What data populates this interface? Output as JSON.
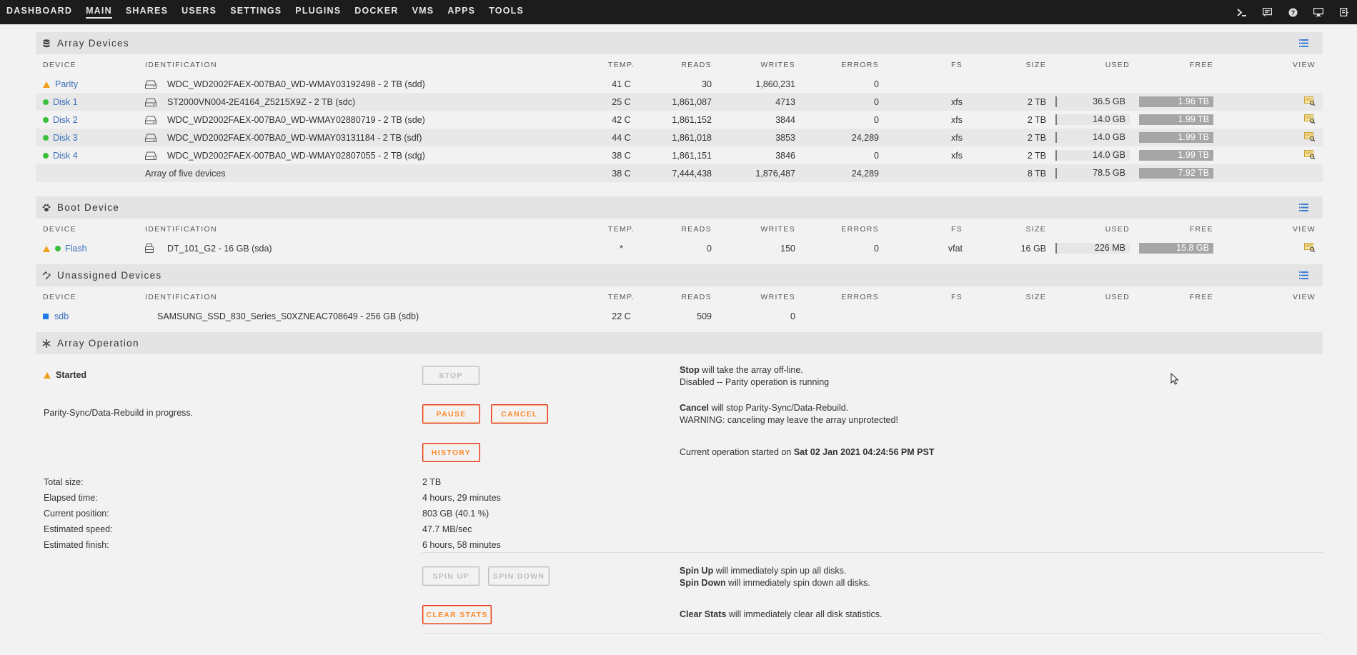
{
  "nav": {
    "items": [
      "DASHBOARD",
      "MAIN",
      "SHARES",
      "USERS",
      "SETTINGS",
      "PLUGINS",
      "DOCKER",
      "VMS",
      "APPS",
      "TOOLS"
    ],
    "active": "MAIN",
    "right_icons": [
      "terminal-icon",
      "feedback-icon",
      "help-icon",
      "monitor-icon",
      "log-icon"
    ]
  },
  "columns": [
    "DEVICE",
    "IDENTIFICATION",
    "TEMP.",
    "READS",
    "WRITES",
    "ERRORS",
    "FS",
    "SIZE",
    "USED",
    "FREE",
    "VIEW"
  ],
  "array": {
    "title": "Array Devices",
    "rows": [
      {
        "status": "warn",
        "device": "Parity",
        "id": "WDC_WD2002FAEX-007BA0_WD-WMAY03192498 - 2 TB (sdd)",
        "temp": "41 C",
        "reads": "30",
        "writes": "1,860,231",
        "errors": "0",
        "fs": "",
        "size": "",
        "used": "",
        "free": "",
        "view": false
      },
      {
        "status": "ok",
        "device": "Disk 1",
        "id": "ST2000VN004-2E4164_Z5215X9Z - 2 TB (sdc)",
        "temp": "25 C",
        "reads": "1,861,087",
        "writes": "4713",
        "errors": "0",
        "fs": "xfs",
        "size": "2 TB",
        "used": "36.5 GB",
        "free": "1.96 TB",
        "view": true
      },
      {
        "status": "ok",
        "device": "Disk 2",
        "id": "WDC_WD2002FAEX-007BA0_WD-WMAY02880719 - 2 TB (sde)",
        "temp": "42 C",
        "reads": "1,861,152",
        "writes": "3844",
        "errors": "0",
        "fs": "xfs",
        "size": "2 TB",
        "used": "14.0 GB",
        "free": "1.99 TB",
        "view": true
      },
      {
        "status": "ok",
        "device": "Disk 3",
        "id": "WDC_WD2002FAEX-007BA0_WD-WMAY03131184 - 2 TB (sdf)",
        "temp": "44 C",
        "reads": "1,861,018",
        "writes": "3853",
        "errors": "24,289",
        "fs": "xfs",
        "size": "2 TB",
        "used": "14.0 GB",
        "free": "1.99 TB",
        "view": true
      },
      {
        "status": "ok",
        "device": "Disk 4",
        "id": "WDC_WD2002FAEX-007BA0_WD-WMAY02807055 - 2 TB (sdg)",
        "temp": "38 C",
        "reads": "1,861,151",
        "writes": "3846",
        "errors": "0",
        "fs": "xfs",
        "size": "2 TB",
        "used": "14.0 GB",
        "free": "1.99 TB",
        "view": true
      }
    ],
    "total": {
      "id": "Array of five devices",
      "temp": "38 C",
      "reads": "7,444,438",
      "writes": "1,876,487",
      "errors": "24,289",
      "size": "8 TB",
      "used": "78.5 GB",
      "free": "7.92 TB"
    }
  },
  "boot": {
    "title": "Boot Device",
    "rows": [
      {
        "device": "Flash",
        "id": "DT_101_G2 - 16 GB (sda)",
        "temp": "*",
        "reads": "0",
        "writes": "150",
        "errors": "0",
        "fs": "vfat",
        "size": "16 GB",
        "used": "226 MB",
        "free": "15.8 GB"
      }
    ]
  },
  "unassigned": {
    "title": "Unassigned Devices",
    "rows": [
      {
        "device": "sdb",
        "id": "SAMSUNG_SSD_830_Series_S0XZNEAC708649 - 256 GB (sdb)",
        "temp": "22 C",
        "reads": "509",
        "writes": "0"
      }
    ]
  },
  "operation": {
    "title": "Array Operation",
    "status": "Started",
    "progress_text": "Parity-Sync/Data-Rebuild in progress.",
    "buttons": {
      "stop": "STOP",
      "pause": "PAUSE",
      "cancel": "CANCEL",
      "history": "HISTORY",
      "spin_up": "SPIN UP",
      "spin_down": "SPIN DOWN",
      "clear_stats": "CLEAR STATS"
    },
    "stop_desc_bold": "Stop",
    "stop_desc": " will take the array off-line.",
    "stop_note": "Disabled -- Parity operation is running",
    "cancel_desc_bold": "Cancel",
    "cancel_desc": " will stop Parity-Sync/Data-Rebuild.",
    "cancel_warn": "WARNING: canceling may leave the array unprotected!",
    "current_op_text": "Current operation started on ",
    "current_op_time": "Sat 02 Jan 2021 04:24:56 PM PST",
    "stats": [
      {
        "label": "Total size:",
        "value": "2 TB"
      },
      {
        "label": "Elapsed time:",
        "value": "4 hours, 29 minutes"
      },
      {
        "label": "Current position:",
        "value": "803 GB (40.1 %)"
      },
      {
        "label": "Estimated speed:",
        "value": "47.7 MB/sec"
      },
      {
        "label": "Estimated finish:",
        "value": "6 hours, 58 minutes"
      }
    ],
    "spinup_bold": "Spin Up",
    "spinup_desc": " will immediately spin up all disks.",
    "spindown_bold": "Spin Down",
    "spindown_desc": " will immediately spin down all disks.",
    "clear_bold": "Clear Stats",
    "clear_desc": " will immediately clear all disk statistics."
  }
}
